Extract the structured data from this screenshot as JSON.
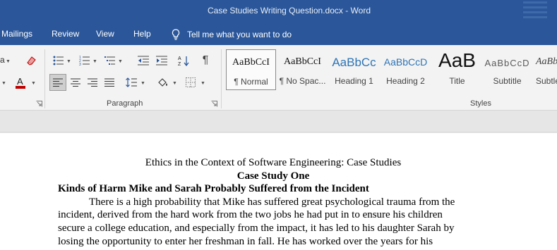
{
  "window": {
    "title": "Case Studies Writing Question.docx  -  Word"
  },
  "menu": {
    "items": [
      "Mailings",
      "Review",
      "View",
      "Help"
    ],
    "tell_me": "Tell me what you want to do"
  },
  "ribbon": {
    "paragraph_group_label": "Paragraph",
    "styles_group_label": "Styles",
    "styles": [
      {
        "sample": "AaBbCcI",
        "name": "¶ Normal",
        "color": "#111111"
      },
      {
        "sample": "AaBbCcI",
        "name": "¶ No Spac...",
        "color": "#111111"
      },
      {
        "sample": "AaBbCc",
        "name": "Heading 1",
        "color": "#2e74b5"
      },
      {
        "sample": "AaBbCcD",
        "name": "Heading 2",
        "color": "#2e74b5"
      },
      {
        "sample": "AaB",
        "name": "Title",
        "color": "#111111"
      },
      {
        "sample": "AaBbCcD",
        "name": "Subtitle",
        "color": "#5a5a5a"
      },
      {
        "sample": "AaBbCcD",
        "name": "Subtle",
        "color": "#404040"
      }
    ],
    "accent": "#2b579a",
    "font_color_swatch": "#c00000"
  },
  "document": {
    "title": "Ethics in the Context of Software Engineering: Case Studies",
    "case_heading": "Case Study One",
    "section_heading": "Kinds of Harm Mike and Sarah Probably Suffered from the Incident",
    "body_lines": [
      "There is a high probability that Mike has suffered great psychological trauma from the",
      "incident, derived from the hard work from the two jobs he had put in to ensure his children",
      "secure a college education, and especially from the impact, it has led to his daughter Sarah by",
      "losing the opportunity to enter her freshman in fall. He has worked over the years for his"
    ]
  }
}
